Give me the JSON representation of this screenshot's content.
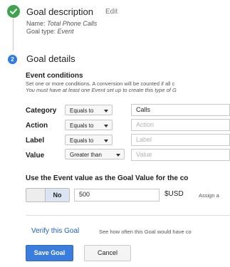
{
  "goal_description": {
    "heading": "Goal description",
    "edit_label": "Edit",
    "name_label": "Name:",
    "name_value": "Total Phone Calls",
    "type_label": "Goal type:",
    "type_value": "Event",
    "status_icon": "check-icon"
  },
  "goal_details": {
    "step_number": "2",
    "heading": "Goal details"
  },
  "event_conditions": {
    "title": "Event conditions",
    "desc_line1": "Set one or more conditions. A conversion will be counted if all c",
    "desc_line2": "You must have at least one Event set up to create this type of G",
    "rows": [
      {
        "label": "Category",
        "operator": "Equals to",
        "value": "Calls",
        "placeholder": ""
      },
      {
        "label": "Action",
        "operator": "Equals to",
        "value": "",
        "placeholder": "Action"
      },
      {
        "label": "Label",
        "operator": "Equals to",
        "value": "",
        "placeholder": "Label"
      },
      {
        "label": "Value",
        "operator": "Greater than",
        "value": "",
        "placeholder": "Value"
      }
    ]
  },
  "goal_value": {
    "heading": "Use the Event value as the Goal Value for the co",
    "toggle_label": "No",
    "amount": "500",
    "currency": "$USD",
    "assign_text": "Assign a"
  },
  "verify": {
    "link_label": "Verify this Goal",
    "description": "See how often this Goal would have co"
  },
  "actions": {
    "save_label": "Save Goal",
    "cancel_label": "Cancel"
  },
  "colors": {
    "primary": "#3b7ddd",
    "link": "#1a62c8",
    "success": "#3fa34d"
  }
}
